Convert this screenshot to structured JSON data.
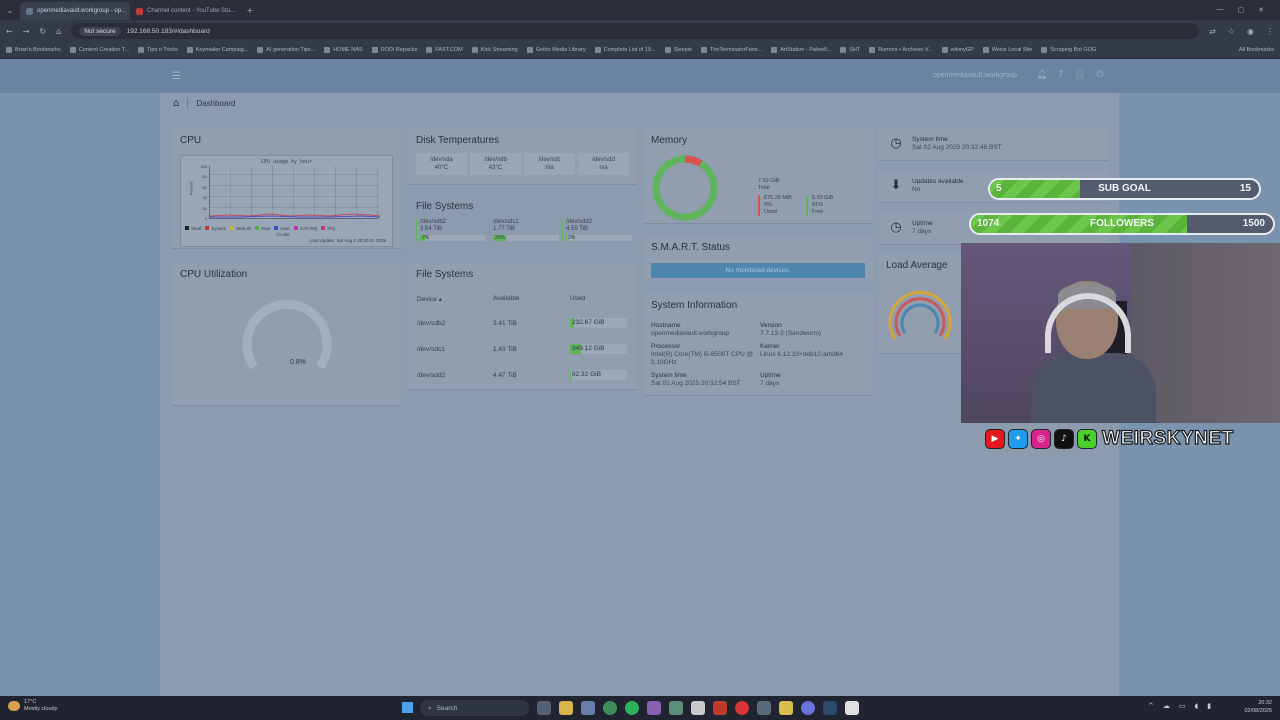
{
  "browser": {
    "tabs": [
      {
        "label": "openmediavault.workgroup - op...",
        "active": true
      },
      {
        "label": "Channel content - YouTube Stu...",
        "active": false
      }
    ],
    "security_label": "Not secure",
    "url": "192.168.50.183/#/dashboard",
    "bookmarks": [
      "Brian's Bookmarks",
      "Content Creation T...",
      "Tips n Tricks",
      "Keymailer Campaig...",
      "AI generation Tips...",
      "HOME NAS",
      "DODI Repacks",
      "FAST.COM",
      "Kick Streaming",
      "Gotho Media Library",
      "Complete List of 19...",
      "Sleepio",
      "TheTerminatorFans...",
      "ArtStation - Palwell...",
      "SHT",
      "Rumors • Archives V...",
      "wikmyGP",
      "Weiss Local Site",
      "Scraping Bot GOG"
    ],
    "all_bookmarks": "All Bookmarks"
  },
  "app": {
    "hostname_top": "openmediavault.workgroup",
    "breadcrumb": "Dashboard"
  },
  "cpu": {
    "title": "CPU",
    "graph_title": "CPU usage   by hour",
    "y_label": "Percent",
    "y_ticks": [
      "100",
      "80",
      "60",
      "40",
      "20",
      "0"
    ],
    "legend": [
      "Steal",
      "System",
      "Wait-IO",
      "Nice",
      "User",
      "Soft-IRQ",
      "IRQ"
    ],
    "idle": "13 Idle",
    "last_update": "Last Update: Sat Aug  2 20:30:01 2025"
  },
  "cpu_util": {
    "title": "CPU Utilization",
    "value": "0.8%",
    "value_pct": 0.8
  },
  "disk_temps": {
    "title": "Disk Temperatures",
    "items": [
      {
        "dev": "/dev/sda",
        "temp": "40°C"
      },
      {
        "dev": "/dev/sdb",
        "temp": "43°C"
      },
      {
        "dev": "/dev/sdc",
        "temp": "n/a"
      },
      {
        "dev": "/dev/sdd",
        "temp": "n/a"
      }
    ]
  },
  "fs_tiles": {
    "title": "File Systems",
    "items": [
      {
        "dev": "/dev/sdb2",
        "size": "3.64 TiB",
        "pct_label": "7%",
        "pct": 7
      },
      {
        "dev": "/dev/sdc1",
        "size": "1.77 TiB",
        "pct_label": "20%",
        "pct": 20
      },
      {
        "dev": "/dev/sdd2",
        "size": "4.55 TiB",
        "pct_label": "2%",
        "pct": 2
      }
    ]
  },
  "fs_table": {
    "title": "File Systems",
    "columns": [
      "Device",
      "Available",
      "Used"
    ],
    "rows": [
      {
        "device": "/dev/sdb2",
        "available": "3.41 TiB",
        "used": "232.67 GiB",
        "pct": 7
      },
      {
        "device": "/dev/sdc1",
        "available": "1.43 TiB",
        "used": "349.12 GiB",
        "pct": 20
      },
      {
        "device": "/dev/sdd2",
        "available": "4.47 TiB",
        "used": "82.32 GiB",
        "pct": 2
      }
    ]
  },
  "memory": {
    "title": "Memory",
    "total": "7.59 GiB",
    "total_label": "Total",
    "used": "676.26 MiB",
    "used_pct": "9%",
    "used_label": "Used",
    "free": "6.93 GiB",
    "free_pct": "91%",
    "free_label": "Free",
    "used_fraction": 0.09
  },
  "smart": {
    "title": "S.M.A.R.T. Status",
    "message": "No monitored devices."
  },
  "sysinfo": {
    "title": "System Information",
    "hostname_label": "Hostname",
    "hostname": "openmediavault.workgroup",
    "version_label": "Version",
    "version": "7.7.13-2 (Sandworm)",
    "processor_label": "Processor",
    "processor": "Intel(R) Core(TM) i5-8500T CPU @ 2.10GHz",
    "kernel_label": "Kernel",
    "kernel": "Linux 6.12.33+deb12-amd64",
    "time_label": "System time",
    "time": "Sat 02 Aug 2025 20:32:54 BST",
    "uptime_label": "Uptime",
    "uptime": "7 days"
  },
  "right_panel": {
    "system_time_label": "System time",
    "system_time": "Sat 02 Aug 2025 20:32:48 BST",
    "updates_label": "Updates available",
    "updates": "No",
    "uptime_label": "Uptime",
    "uptime": "7 days",
    "load_label": "Load Average"
  },
  "overlay": {
    "sub_goal": {
      "current": "5",
      "label": "SUB GOAL",
      "target": "15",
      "fraction": 0.333
    },
    "followers": {
      "current": "1074",
      "label": "FOLLOWERS",
      "target": "1500",
      "fraction": 0.716
    },
    "brand": "WEIRSKYNET"
  },
  "taskbar": {
    "weather_temp": "17°C",
    "weather_desc": "Mostly cloudy",
    "search_placeholder": "Search",
    "time": "20:32",
    "date": "02/08/2025"
  },
  "colors": {
    "green": "#5fb55c",
    "red": "#d9534f",
    "blue_banner": "#4f86ad",
    "omv_bg": "#6b86a3"
  }
}
